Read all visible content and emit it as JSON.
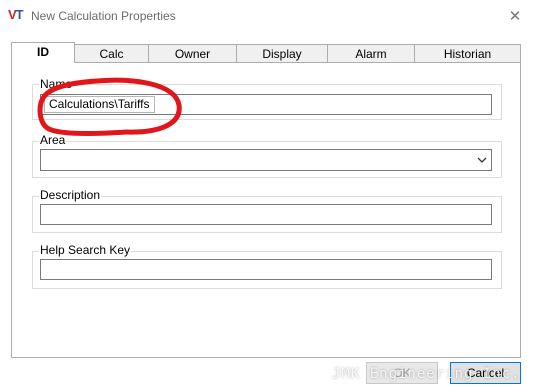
{
  "window": {
    "logo_text": "VT",
    "title": "New Calculation Properties",
    "close_glyph": "✕"
  },
  "tabs": [
    {
      "label": "ID",
      "active": true
    },
    {
      "label": "Calc",
      "active": false
    },
    {
      "label": "Owner",
      "active": false
    },
    {
      "label": "Display",
      "active": false
    },
    {
      "label": "Alarm",
      "active": false
    },
    {
      "label": "Historian",
      "active": false
    }
  ],
  "fields": {
    "name": {
      "label": "Name",
      "value": "Calculations\\Tariffs"
    },
    "area": {
      "label": "Area",
      "value": ""
    },
    "description": {
      "label": "Description",
      "value": ""
    },
    "help_search_key": {
      "label": "Help Search Key",
      "value": ""
    }
  },
  "buttons": {
    "ok": "OK",
    "cancel": "Cancel"
  },
  "watermark": "JMK Engineering Inc.",
  "colors": {
    "annotation": "#e0161b",
    "logo_v": "#c62828",
    "logo_t": "#2e5aa8",
    "focus_border": "#0078d7"
  }
}
